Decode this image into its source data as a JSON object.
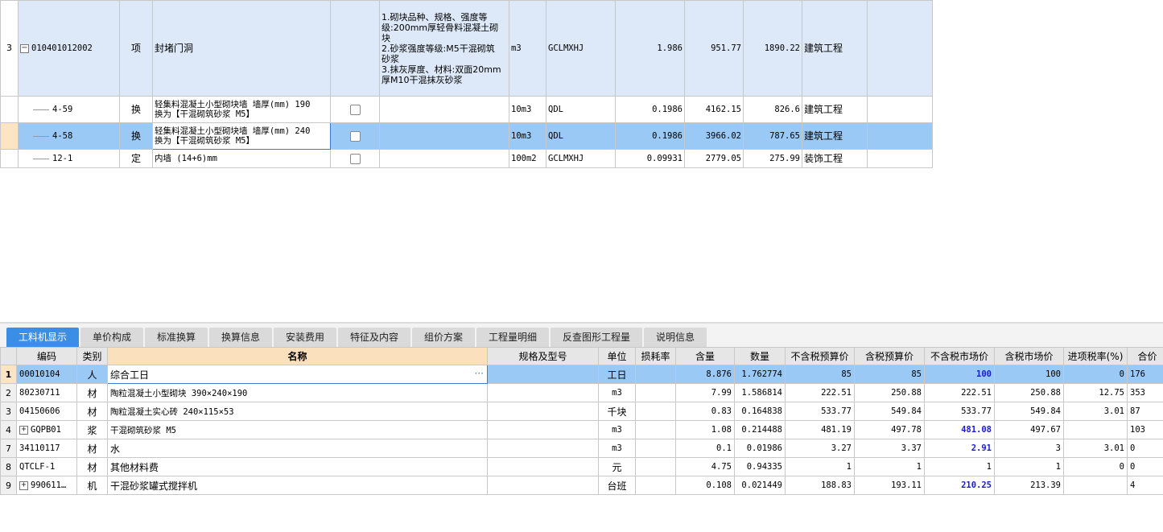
{
  "top_grid": {
    "rows": [
      {
        "row_no": "3",
        "code": "010401012002",
        "type": "项",
        "name": "封堵门洞",
        "features": [
          "1.砌块品种、规格、强度等",
          "级:200mm厚轻骨料混凝土砌块",
          "2.砂浆强度等级:M5干混砌筑",
          "砂浆",
          "3.抹灰厚度、材料:双面20mm",
          "厚M10干混抹灰砂浆"
        ],
        "unit": "m3",
        "expr": "GCLMXHJ",
        "qty": "1.986",
        "price": "951.77",
        "total": "1890.22",
        "specialty": "建筑工程",
        "toggle": "−"
      },
      {
        "row_no": "",
        "code": "4-59",
        "type": "换",
        "name_line1": "轻集料混凝土小型砌块墙 墙厚(mm) 190",
        "name_line2": " 换为【干混砌筑砂浆 M5】",
        "unit": "10m3",
        "expr": "QDL",
        "qty": "0.1986",
        "price": "4162.15",
        "total": "826.6",
        "specialty": "建筑工程"
      },
      {
        "row_no": "",
        "code": "4-58",
        "type": "换",
        "name_line1": "轻集料混凝土小型砌块墙 墙厚(mm) 240",
        "name_line2": " 换为【干混砌筑砂浆 M5】",
        "unit": "10m3",
        "expr": "QDL",
        "qty": "0.1986",
        "price": "3966.02",
        "total": "787.65",
        "specialty": "建筑工程"
      },
      {
        "row_no": "",
        "code": "12-1",
        "type": "定",
        "name_line1": "内墙 (14+6)mm",
        "unit": "100m2",
        "expr": "GCLMXHJ",
        "qty": "0.09931",
        "price": "2779.05",
        "total": "275.99",
        "specialty": "装饰工程"
      }
    ]
  },
  "tabs": [
    "工料机显示",
    "单价构成",
    "标准换算",
    "换算信息",
    "安装费用",
    "特征及内容",
    "组价方案",
    "工程量明细",
    "反查图形工程量",
    "说明信息"
  ],
  "bottom_grid": {
    "headers": [
      "编码",
      "类别",
      "名称",
      "规格及型号",
      "单位",
      "损耗率",
      "含量",
      "数量",
      "不含税预算价",
      "含税预算价",
      "不含税市场价",
      "含税市场价",
      "进项税率(%)",
      "合价"
    ],
    "rows": [
      {
        "no": "1",
        "code": "00010104",
        "cat": "人",
        "name": "综合工日",
        "spec": "",
        "unit": "工日",
        "loss": "",
        "content": "8.876",
        "qty": "1.762774",
        "pre_notax": "85",
        "pre_tax": "85",
        "mkt_notax": "100",
        "mkt_tax": "100",
        "tax_rate": "0",
        "total": "176",
        "ellipsis": "···"
      },
      {
        "no": "2",
        "code": "80230711",
        "cat": "材",
        "name": "陶粒混凝土小型砌块 390×240×190",
        "spec": "",
        "unit": "m3",
        "loss": "",
        "content": "7.99",
        "qty": "1.586814",
        "pre_notax": "222.51",
        "pre_tax": "250.88",
        "mkt_notax": "222.51",
        "mkt_tax": "250.88",
        "tax_rate": "12.75",
        "total": "353"
      },
      {
        "no": "3",
        "code": "04150606",
        "cat": "材",
        "name": "陶粒混凝土实心砖 240×115×53",
        "spec": "",
        "unit": "千块",
        "loss": "",
        "content": "0.83",
        "qty": "0.164838",
        "pre_notax": "533.77",
        "pre_tax": "549.84",
        "mkt_notax": "533.77",
        "mkt_tax": "549.84",
        "tax_rate": "3.01",
        "total": "87"
      },
      {
        "no": "4",
        "code": "GQPB01",
        "cat": "浆",
        "name": "干混砌筑砂浆 M5",
        "spec": "",
        "unit": "m3",
        "loss": "",
        "content": "1.08",
        "qty": "0.214488",
        "pre_notax": "481.19",
        "pre_tax": "497.78",
        "mkt_notax": "481.08",
        "mkt_tax": "497.67",
        "tax_rate": "",
        "total": "103",
        "toggle": "+"
      },
      {
        "no": "7",
        "code": "34110117",
        "cat": "材",
        "name": "水",
        "spec": "",
        "unit": "m3",
        "loss": "",
        "content": "0.1",
        "qty": "0.01986",
        "pre_notax": "3.27",
        "pre_tax": "3.37",
        "mkt_notax": "2.91",
        "mkt_tax": "3",
        "tax_rate": "3.01",
        "total": "0"
      },
      {
        "no": "8",
        "code": "QTCLF-1",
        "cat": "材",
        "name": "其他材料费",
        "spec": "",
        "unit": "元",
        "loss": "",
        "content": "4.75",
        "qty": "0.94335",
        "pre_notax": "1",
        "pre_tax": "1",
        "mkt_notax": "1",
        "mkt_tax": "1",
        "tax_rate": "0",
        "total": "0"
      },
      {
        "no": "9",
        "code": "990611…",
        "cat": "机",
        "name": "干混砂浆罐式搅拌机",
        "spec": "",
        "unit": "台班",
        "loss": "",
        "content": "0.108",
        "qty": "0.021449",
        "pre_notax": "188.83",
        "pre_tax": "193.11",
        "mkt_notax": "210.25",
        "mkt_tax": "213.39",
        "tax_rate": "",
        "total": "4",
        "toggle": "+"
      }
    ]
  },
  "colors": {
    "selected_row": "#99c9f4",
    "parent_row": "#dde9f8",
    "active_tab": "#3a8ee6",
    "highlight_text": "#1a1ad0",
    "name_header": "#fbe0bd"
  }
}
